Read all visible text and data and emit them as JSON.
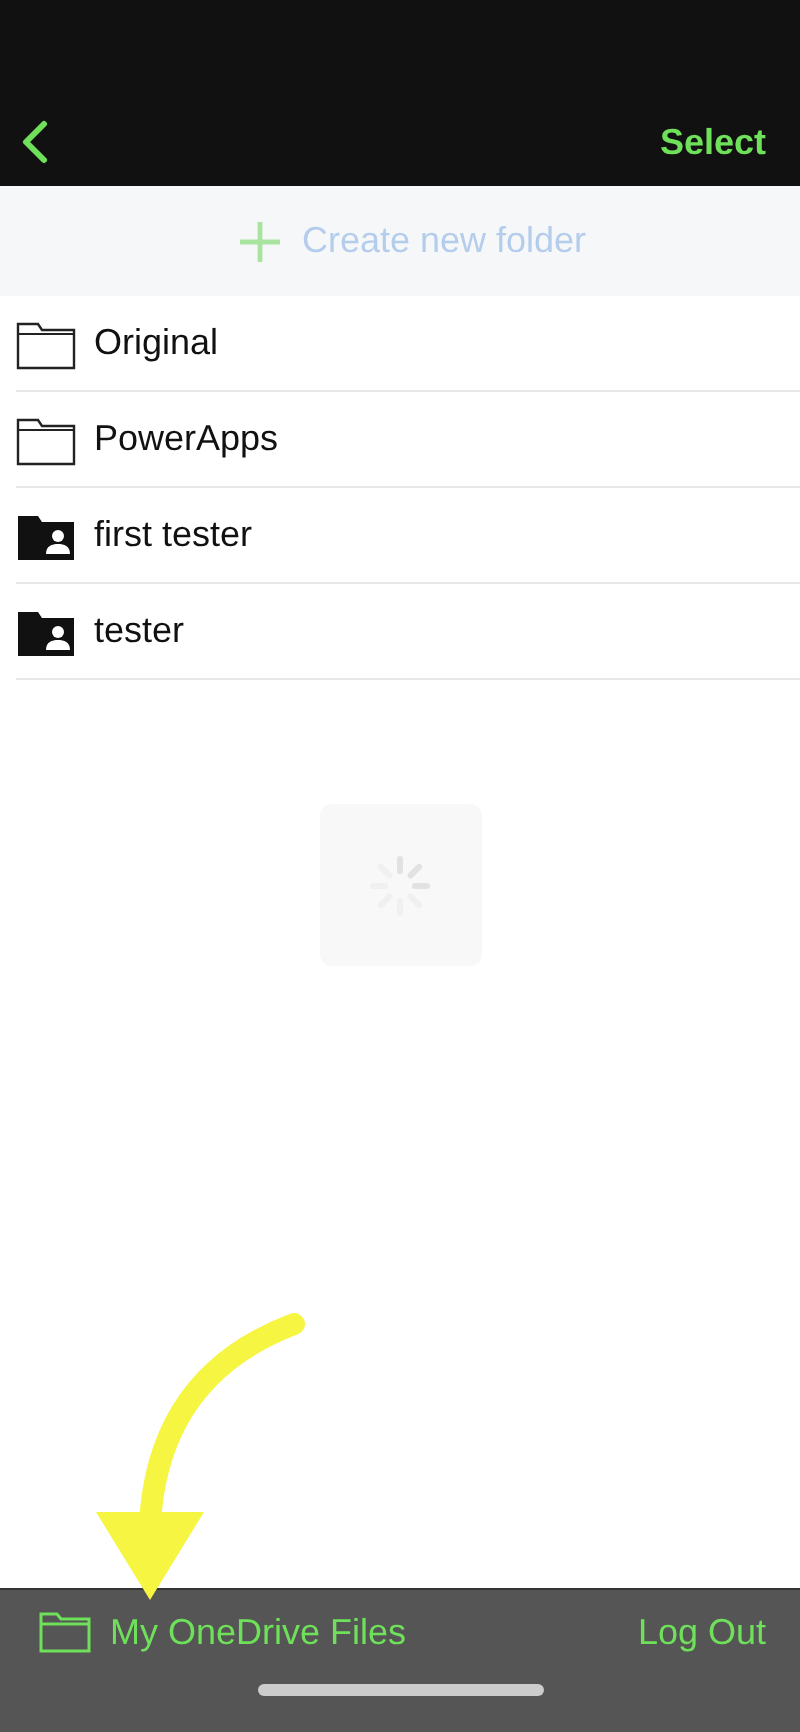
{
  "nav_bar": {
    "select_label": "Select"
  },
  "create_folder": {
    "label": "Create new folder"
  },
  "folders": [
    {
      "name": "Original",
      "kind": "plain"
    },
    {
      "name": "PowerApps",
      "kind": "plain"
    },
    {
      "name": "first tester",
      "kind": "shared"
    },
    {
      "name": "tester",
      "kind": "shared"
    }
  ],
  "loading": true,
  "bottom_bar": {
    "location_label": "My OneDrive Files",
    "logout_label": "Log Out"
  }
}
